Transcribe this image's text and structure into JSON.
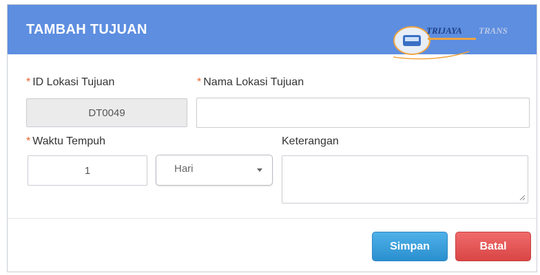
{
  "dialog": {
    "title": "TAMBAH TUJUAN",
    "logo": {
      "brand_a": "TRIJAYA",
      "brand_b": "TRANS"
    }
  },
  "form": {
    "id_label": "ID Lokasi Tujuan",
    "id_value": "DT0049",
    "name_label": "Nama Lokasi Tujuan",
    "name_value": "",
    "time_label": "Waktu Tempuh",
    "time_value": "1",
    "unit_value": "Hari",
    "notes_label": "Keterangan",
    "notes_value": "",
    "required_marker": "*"
  },
  "buttons": {
    "save_label": "Simpan",
    "cancel_label": "Batal"
  },
  "colors": {
    "header": "#5d8ee0",
    "required": "#e8632b",
    "save": "#2a8fcf",
    "cancel": "#d94545"
  }
}
